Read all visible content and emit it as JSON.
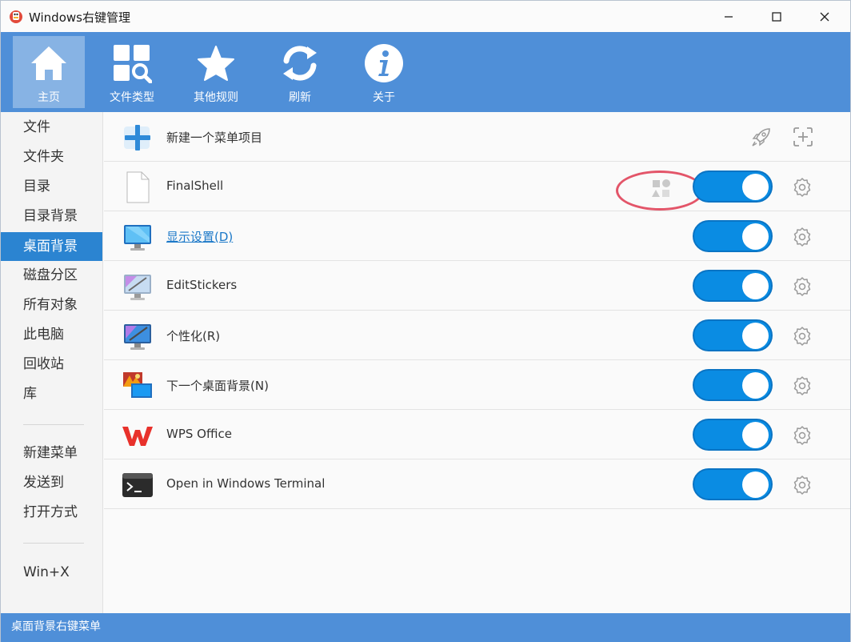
{
  "window": {
    "title": "Windows右键管理",
    "min_label": "─",
    "max_label": "☐",
    "close_label": "✕"
  },
  "colors": {
    "accent": "#4f8fd8",
    "selected": "#2b84d1",
    "toggle_on": "#0a8ce3",
    "highlight_ring": "#e35569"
  },
  "toolbar": {
    "items": [
      {
        "label": "主页",
        "icon": "home-icon",
        "active": true
      },
      {
        "label": "文件类型",
        "icon": "file-types-icon",
        "active": false
      },
      {
        "label": "其他规则",
        "icon": "star-icon",
        "active": false
      },
      {
        "label": "刷新",
        "icon": "refresh-icon",
        "active": false
      },
      {
        "label": "关于",
        "icon": "info-icon",
        "active": false
      }
    ]
  },
  "sidebar": {
    "items": [
      {
        "label": "文件"
      },
      {
        "label": "文件夹"
      },
      {
        "label": "目录"
      },
      {
        "label": "目录背景"
      },
      {
        "label": "桌面背景",
        "selected": true
      },
      {
        "label": "磁盘分区"
      },
      {
        "label": "所有对象"
      },
      {
        "label": "此电脑"
      },
      {
        "label": "回收站"
      },
      {
        "label": "库"
      },
      {
        "label": "新建菜单"
      },
      {
        "label": "发送到"
      },
      {
        "label": "打开方式"
      },
      {
        "label": "Win+X"
      }
    ]
  },
  "main": {
    "new_item": {
      "label": "新建一个菜单项目",
      "icon": "plus-icon"
    },
    "rows": [
      {
        "label": "FinalShell",
        "icon": "blank-file-icon",
        "enabled": true
      },
      {
        "label": "显示设置(D)",
        "icon": "display-icon",
        "enabled": true,
        "link": true
      },
      {
        "label": "EditStickers",
        "icon": "monitor-pen-icon",
        "enabled": true
      },
      {
        "label": "个性化(R)",
        "icon": "personalize-icon",
        "enabled": true
      },
      {
        "label": "下一个桌面背景(N)",
        "icon": "next-wallpaper-icon",
        "enabled": true
      },
      {
        "label": "WPS Office",
        "icon": "wps-icon",
        "enabled": true
      },
      {
        "label": "Open in Windows Terminal",
        "icon": "terminal-icon",
        "enabled": true
      }
    ]
  },
  "status": {
    "text": "桌面背景右键菜单"
  }
}
